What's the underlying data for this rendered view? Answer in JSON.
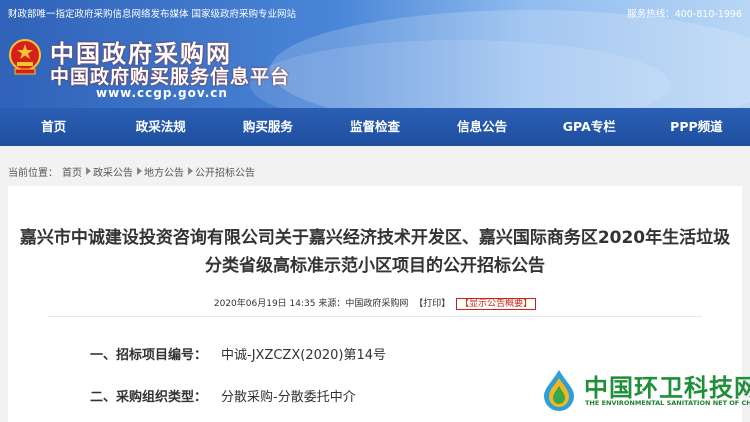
{
  "topbar": {
    "notice": "财政部唯一指定政府采购信息网络发布媒体  国家级政府采购专业网站",
    "hotline": "服务热线：400-810-1996"
  },
  "brand": {
    "title": "中国政府采购网",
    "subtitle": "中国政府购买服务信息平台",
    "url": "www.ccgp.gov.cn"
  },
  "nav": [
    "首页",
    "政采法规",
    "购买服务",
    "监督检查",
    "信息公告",
    "GPA专栏",
    "PPP频道"
  ],
  "breadcrumb": {
    "label": "当前位置：",
    "items": [
      "首页",
      "政采公告",
      "地方公告",
      "公开招标公告"
    ]
  },
  "article": {
    "title": "嘉兴市中诚建设投资咨询有限公司关于嘉兴经济技术开发区、嘉兴国际商务区2020年生活垃圾分类省级高标准示范小区项目的公开招标公告",
    "meta": "2020年06月19日 14:35 来源：中国政府采购网",
    "print_label": "【打印】",
    "summary_label": "【显示公告概要】",
    "fields": [
      {
        "label": "一、招标项目编号：",
        "value": "中诚-JXZCZX(2020)第14号"
      },
      {
        "label": "二、采购组织类型：",
        "value": "分散采购-分散委托中介"
      }
    ]
  },
  "watermark": {
    "cn": "中国环卫科技网",
    "en": "THE ENVIRONMENTAL SANITATION NET OF CHINA"
  },
  "colors": {
    "nav": "#2a5fb4",
    "accent": "#c21",
    "logo_green": "#1f8f3a"
  }
}
